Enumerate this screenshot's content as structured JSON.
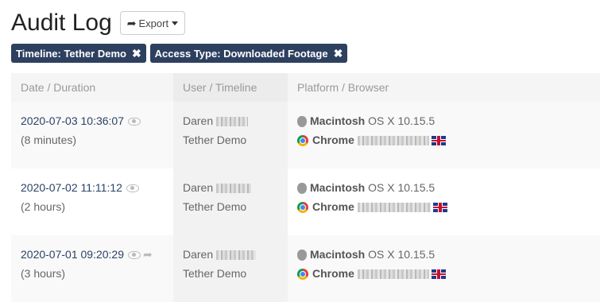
{
  "page": {
    "title": "Audit Log"
  },
  "toolbar": {
    "export_label": "Export"
  },
  "filters": [
    {
      "label": "Timeline: Tether Demo"
    },
    {
      "label": "Access Type: Downloaded Footage"
    }
  ],
  "table": {
    "headers": [
      "Date / Duration",
      "User / Timeline",
      "Platform / Browser"
    ],
    "rows": [
      {
        "date": "2020-07-03 10:36:07",
        "duration": "(8 minutes)",
        "user": "Daren",
        "timeline": "Tether Demo",
        "os_name": "Macintosh",
        "os_version": "OS X 10.15.5",
        "browser": "Chrome",
        "shared": false
      },
      {
        "date": "2020-07-02 11:11:12",
        "duration": "(2 hours)",
        "user": "Daren",
        "timeline": "Tether Demo",
        "os_name": "Macintosh",
        "os_version": "OS X 10.15.5",
        "browser": "Chrome",
        "shared": false
      },
      {
        "date": "2020-07-01 09:20:29",
        "duration": "(3 hours)",
        "user": "Daren",
        "timeline": "Tether Demo",
        "os_name": "Macintosh",
        "os_version": "OS X 10.15.5",
        "browser": "Chrome",
        "shared": true
      }
    ]
  },
  "icons": {
    "export": "share-icon",
    "remove_filter": "close-icon",
    "view": "eye-icon",
    "os": "apple-icon",
    "browser": "chrome-icon",
    "locale": "uk-flag-icon"
  },
  "colors": {
    "chip_bg": "#2e4060",
    "date_link": "#2b4366"
  }
}
